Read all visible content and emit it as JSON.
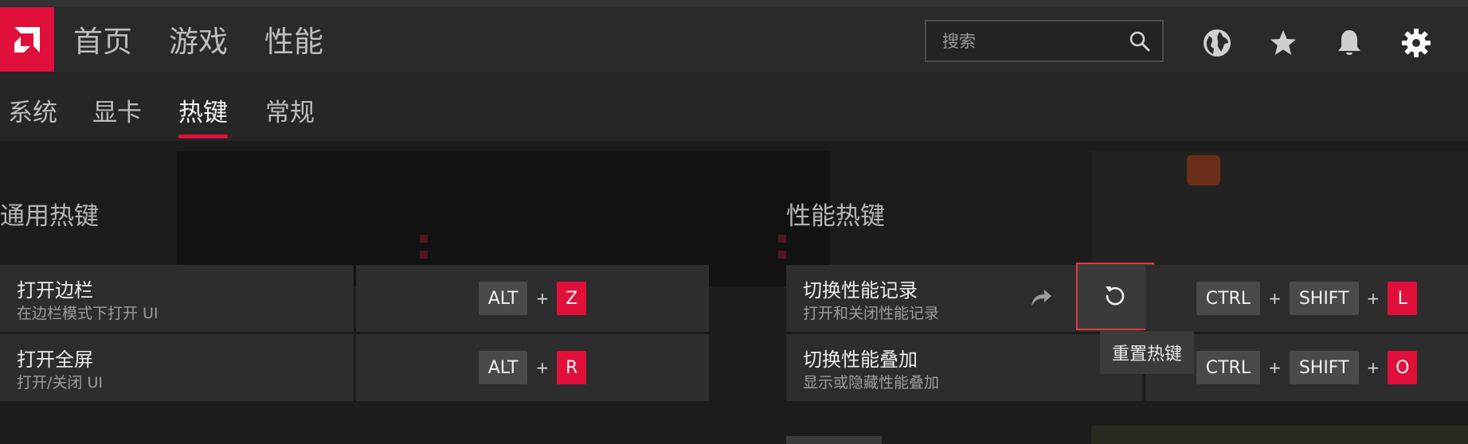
{
  "top_nav": {
    "items": [
      "首页",
      "游戏",
      "性能"
    ]
  },
  "search": {
    "placeholder": "搜索"
  },
  "top_icons": [
    "globe-icon",
    "star-icon",
    "bell-icon",
    "gear-icon"
  ],
  "sub_tabs": {
    "items": [
      "系统",
      "显卡",
      "热键",
      "常规"
    ],
    "active": "热键"
  },
  "general": {
    "title": "通用热键",
    "rows": [
      {
        "name": "打开边栏",
        "desc": "在边栏模式下打开 UI",
        "keys": [
          "ALT",
          "Z"
        ]
      },
      {
        "name": "打开全屏",
        "desc": "打开/关闭 UI",
        "keys": [
          "ALT",
          "R"
        ]
      }
    ]
  },
  "performance": {
    "title": "性能热键",
    "rows": [
      {
        "name": "切换性能记录",
        "desc": "打开和关闭性能记录",
        "keys": [
          "CTRL",
          "SHIFT",
          "L"
        ]
      },
      {
        "name": "切换性能叠加",
        "desc": "显示或隐藏性能叠加",
        "keys": [
          "CTRL",
          "SHIFT",
          "O"
        ]
      }
    ]
  },
  "plus": "+",
  "tooltip": "重置热键",
  "colors": {
    "accent": "#e0103a",
    "highlight_border": "#e23a3a"
  }
}
